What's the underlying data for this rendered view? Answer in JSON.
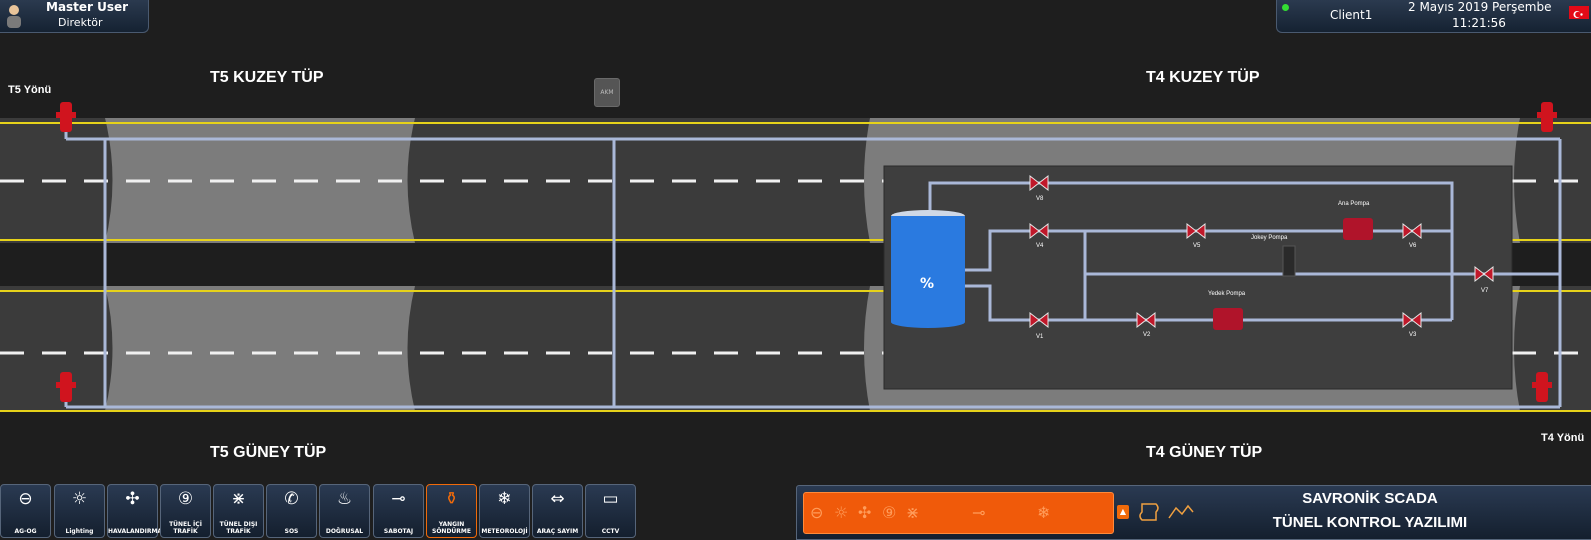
{
  "header": {
    "user_name": "Master User",
    "user_role": "Direktör",
    "client_name": "Client1",
    "date": "2 Mayıs 2019 Perşembe",
    "time": "11:21:56"
  },
  "map": {
    "t5_kuzey": "T5 KUZEY TÜP",
    "t4_kuzey": "T4 KUZEY TÜP",
    "t5_guney": "T5 GÜNEY TÜP",
    "t4_guney": "T4 GÜNEY TÜP",
    "t5_yonu": "T5 Yönü",
    "t4_yonu": "T4 Yönü",
    "akm": "AKM",
    "tank_label": "%",
    "valves": {
      "v8": "V8",
      "v4": "V4",
      "v5": "V5",
      "v6": "V6",
      "v7": "V7",
      "v1": "V1",
      "v2": "V2",
      "v3": "V3"
    },
    "pumps": {
      "ana": "Ana Pompa",
      "jokey": "Jokey Pompa",
      "yedek": "Yedek Pompa"
    }
  },
  "toolbar": [
    {
      "label": "AG-OG",
      "icon": "⊖"
    },
    {
      "label": "Lighting",
      "icon": "☼"
    },
    {
      "label": "HAVALANDIRMA",
      "icon": "✣"
    },
    {
      "label": "TÜNEL İÇİ TRAFİK",
      "icon": "⑨"
    },
    {
      "label": "TÜNEL DIŞI TRAFİK",
      "icon": "⋇"
    },
    {
      "label": "SOS",
      "icon": "✆"
    },
    {
      "label": "DOĞRUSAL",
      "icon": "♨"
    },
    {
      "label": "SABOTAJ",
      "icon": "⊸"
    },
    {
      "label": "YANGIN SÖNDÜRME",
      "icon": "⚱"
    },
    {
      "label": "METEOROLOJİ",
      "icon": "❄"
    },
    {
      "label": "ARAÇ SAYIM",
      "icon": "⇔"
    },
    {
      "label": "CCTV",
      "icon": "▭"
    }
  ],
  "footer": {
    "title": "SAVRONİK SCADA",
    "subtitle": "TÜNEL KONTROL YAZILIMI",
    "alarm_icons": [
      "⊖",
      "☼",
      "✣",
      "⑨",
      "⋇",
      "⊸",
      "❄"
    ]
  },
  "colors": {
    "active_border": "#f06a0a",
    "alarm_bar": "#f05a0a",
    "valve": "#c0182a",
    "tank": "#2a7ae0"
  }
}
